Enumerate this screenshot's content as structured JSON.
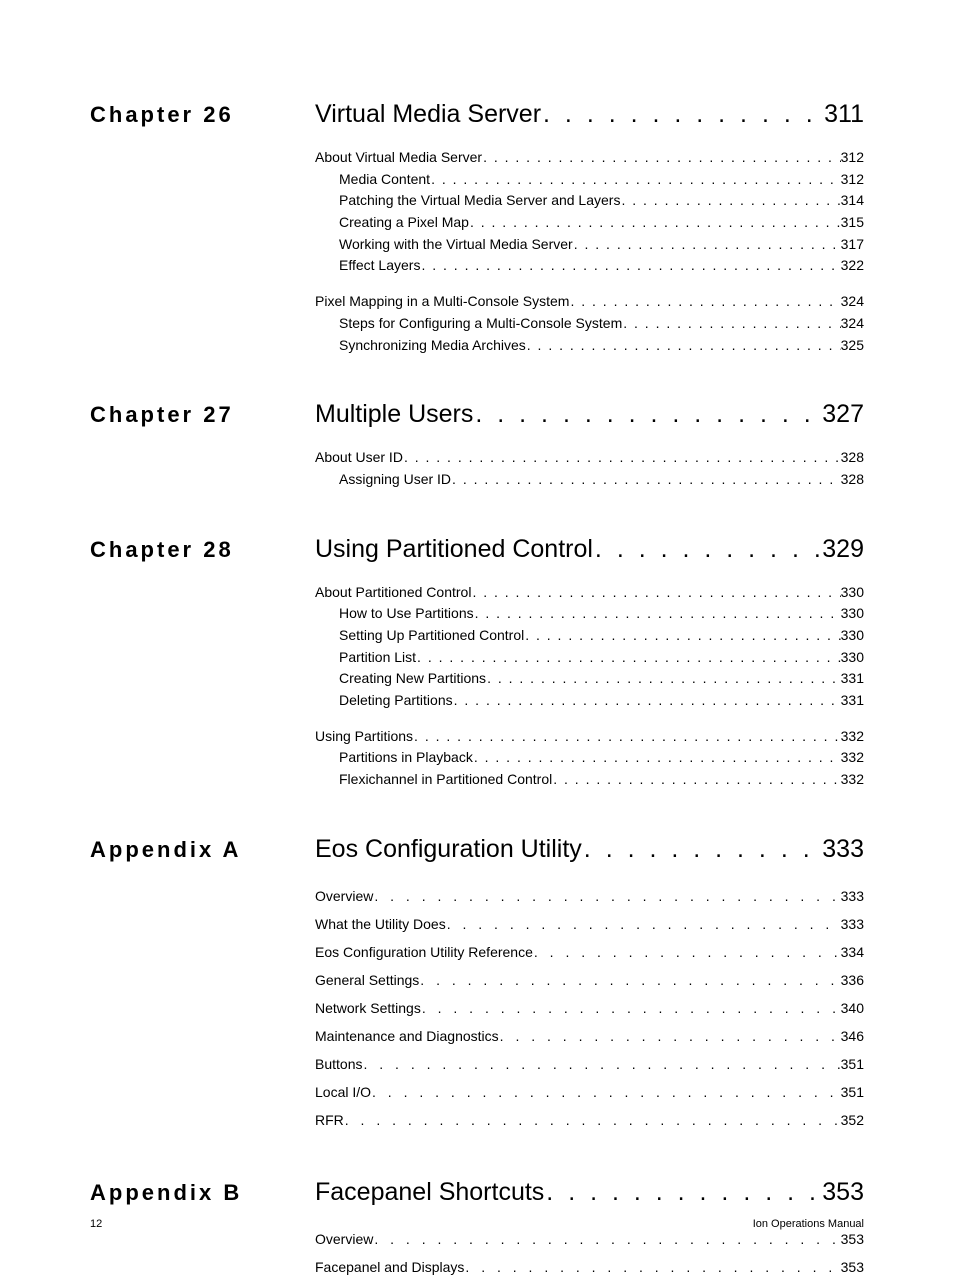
{
  "sections": [
    {
      "label": "Chapter 26",
      "title": "Virtual Media Server",
      "page": "311",
      "groups": [
        {
          "lines": [
            {
              "title": "About Virtual Media Server ",
              "page": "312",
              "indent": 0
            },
            {
              "title": "Media Content ",
              "page": "312",
              "indent": 1
            },
            {
              "title": "Patching the Virtual Media Server and Layers ",
              "page": "314",
              "indent": 1
            },
            {
              "title": "Creating a Pixel Map ",
              "page": "315",
              "indent": 1
            },
            {
              "title": "Working with the Virtual Media Server",
              "page": "317",
              "indent": 1
            },
            {
              "title": "Effect Layers ",
              "page": "322",
              "indent": 1
            }
          ]
        },
        {
          "lines": [
            {
              "title": "Pixel Mapping in a Multi-Console System ",
              "page": "324",
              "indent": 0
            },
            {
              "title": "Steps for Configuring a Multi-Console System ",
              "page": "324",
              "indent": 1
            },
            {
              "title": "Synchronizing Media Archives",
              "page": "325",
              "indent": 1
            }
          ]
        }
      ]
    },
    {
      "label": "Chapter 27",
      "title": "Multiple Users",
      "page": "327",
      "groups": [
        {
          "lines": [
            {
              "title": "About User ID",
              "page": "328",
              "indent": 0
            },
            {
              "title": "Assigning User ID ",
              "page": "328",
              "indent": 1
            }
          ]
        }
      ]
    },
    {
      "label": "Chapter 28",
      "title": "Using Partitioned Control ",
      "page": "329",
      "groups": [
        {
          "lines": [
            {
              "title": "About Partitioned Control ",
              "page": "330",
              "indent": 0
            },
            {
              "title": "How to Use Partitions ",
              "page": "330",
              "indent": 1
            },
            {
              "title": "Setting Up Partitioned Control ",
              "page": "330",
              "indent": 1
            },
            {
              "title": "Partition List",
              "page": "330",
              "indent": 1
            },
            {
              "title": "Creating New Partitions",
              "page": "331",
              "indent": 1
            },
            {
              "title": "Deleting Partitions ",
              "page": "331",
              "indent": 1
            }
          ]
        },
        {
          "lines": [
            {
              "title": "Using Partitions ",
              "page": "332",
              "indent": 0
            },
            {
              "title": "Partitions in Playback ",
              "page": "332",
              "indent": 1
            },
            {
              "title": "Flexichannel in Partitioned Control ",
              "page": "332",
              "indent": 1
            }
          ]
        }
      ]
    },
    {
      "label": "Appendix A",
      "title": "Eos Configuration Utility ",
      "page": "333",
      "spaced": true,
      "widedots": true,
      "groups": [
        {
          "lines": [
            {
              "title": "Overview ",
              "page": " 333",
              "indent": 0
            },
            {
              "title": "What the Utility Does ",
              "page": " 333",
              "indent": 0
            },
            {
              "title": "Eos Configuration Utility Reference ",
              "page": " 334",
              "indent": 0
            },
            {
              "title": "General Settings",
              "page": " 336",
              "indent": 0
            },
            {
              "title": "Network Settings ",
              "page": " 340",
              "indent": 0
            },
            {
              "title": "Maintenance and Diagnostics ",
              "page": " 346",
              "indent": 0
            },
            {
              "title": "Buttons ",
              "page": " 351",
              "indent": 0
            },
            {
              "title": "Local I/O ",
              "page": " 351",
              "indent": 0
            },
            {
              "title": "RFR ",
              "page": " 352",
              "indent": 0
            }
          ]
        }
      ]
    },
    {
      "label": "Appendix B",
      "title": "Facepanel Shortcuts",
      "page": "353",
      "spaced": true,
      "widedots": true,
      "groups": [
        {
          "lines": [
            {
              "title": "Overview ",
              "page": " 353",
              "indent": 0
            },
            {
              "title": "Facepanel and Displays ",
              "page": " 353",
              "indent": 0
            }
          ]
        }
      ]
    }
  ],
  "footer": {
    "left": "12",
    "right": "Ion Operations Manual"
  },
  "dotfill": ". . . . . . . . . . . . . . . . . . . . . . . . . . . . . . . . . . . . . . . . . . . . . . . . . . . . . . . . . . . . . . . . . . . . . . . . . . . . . . . . . . . . . . . . . . . . . . . . . . . . . . . . . . . . . . ."
}
